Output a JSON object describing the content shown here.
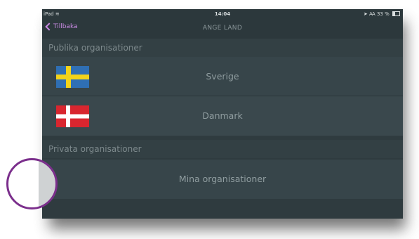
{
  "statusbar": {
    "device": "iPad",
    "time": "14:04",
    "right": "33 %"
  },
  "navbar": {
    "back_label": "Tillbaka",
    "title": "ANGE LAND"
  },
  "sections": {
    "public": {
      "header": "Publika organisationer",
      "items": [
        {
          "label": "Sverige",
          "flag": "sweden-flag"
        },
        {
          "label": "Danmark",
          "flag": "denmark-flag"
        }
      ]
    },
    "private": {
      "header": "Privata organisationer",
      "items": [
        {
          "label": "Mina organisationer"
        }
      ]
    }
  },
  "colors": {
    "background": "#2f3b3f",
    "accent": "#c98ae3",
    "touch_indicator": "#7b2f8c"
  }
}
